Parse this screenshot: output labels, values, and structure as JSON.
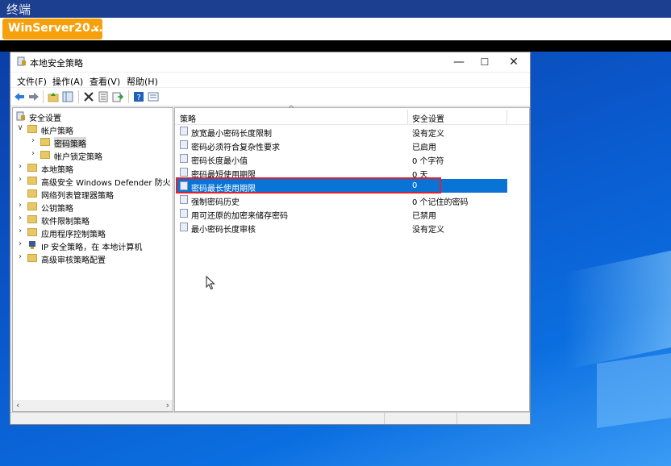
{
  "terminal": {
    "title": "终端",
    "tab_label": "WinServer20...",
    "tab_close": "×"
  },
  "window": {
    "title": "本地安全策略",
    "controls": {
      "minimize": "—",
      "maximize": "☐",
      "close": "✕"
    },
    "menu": [
      {
        "label": "文件(F)"
      },
      {
        "label": "操作(A)"
      },
      {
        "label": "查看(V)"
      },
      {
        "label": "帮助(H)"
      }
    ],
    "toolbar_icons": [
      "back-icon",
      "forward-icon",
      "up-folder-icon",
      "show-hide-tree-icon",
      "delete-icon",
      "properties-icon",
      "export-icon",
      "help-icon",
      "view-icon"
    ]
  },
  "tree": [
    {
      "label": "安全设置",
      "level": 0,
      "expander": "",
      "icon": "security-settings-icon"
    },
    {
      "label": "帐户策略",
      "level": 1,
      "expander": "∨",
      "icon": "folder-icon"
    },
    {
      "label": "密码策略",
      "level": 2,
      "expander": "›",
      "icon": "folder-icon",
      "selected": true
    },
    {
      "label": "帐户锁定策略",
      "level": 2,
      "expander": "›",
      "icon": "folder-icon"
    },
    {
      "label": "本地策略",
      "level": 1,
      "expander": "›",
      "icon": "folder-icon"
    },
    {
      "label": "高级安全 Windows Defender 防火墙",
      "level": 1,
      "expander": "›",
      "icon": "folder-icon"
    },
    {
      "label": "网络列表管理器策略",
      "level": 1,
      "expander": "",
      "icon": "folder-icon"
    },
    {
      "label": "公钥策略",
      "level": 1,
      "expander": "›",
      "icon": "folder-icon"
    },
    {
      "label": "软件限制策略",
      "level": 1,
      "expander": "›",
      "icon": "folder-icon"
    },
    {
      "label": "应用程序控制策略",
      "level": 1,
      "expander": "›",
      "icon": "folder-icon"
    },
    {
      "label": "IP 安全策略，在 本地计算机",
      "level": 1,
      "expander": "›",
      "icon": "ip-security-icon"
    },
    {
      "label": "高级审核策略配置",
      "level": 1,
      "expander": "›",
      "icon": "folder-icon"
    }
  ],
  "tree_scroll": {
    "left": "‹",
    "right": "›"
  },
  "columns": {
    "policy": "策略",
    "setting": "安全设置",
    "sort_caret": "^"
  },
  "policies": [
    {
      "name": "放宽最小密码长度限制",
      "value": "没有定义"
    },
    {
      "name": "密码必须符合复杂性要求",
      "value": "已启用"
    },
    {
      "name": "密码长度最小值",
      "value": "0 个字符"
    },
    {
      "name": "密码最短使用期限",
      "value": "0 天"
    },
    {
      "name": "密码最长使用期限",
      "value": "0",
      "selected": true
    },
    {
      "name": "强制密码历史",
      "value": "0 个记住的密码"
    },
    {
      "name": "用可还原的加密来储存密码",
      "value": "已禁用"
    },
    {
      "name": "最小密码长度审核",
      "value": "没有定义"
    }
  ]
}
